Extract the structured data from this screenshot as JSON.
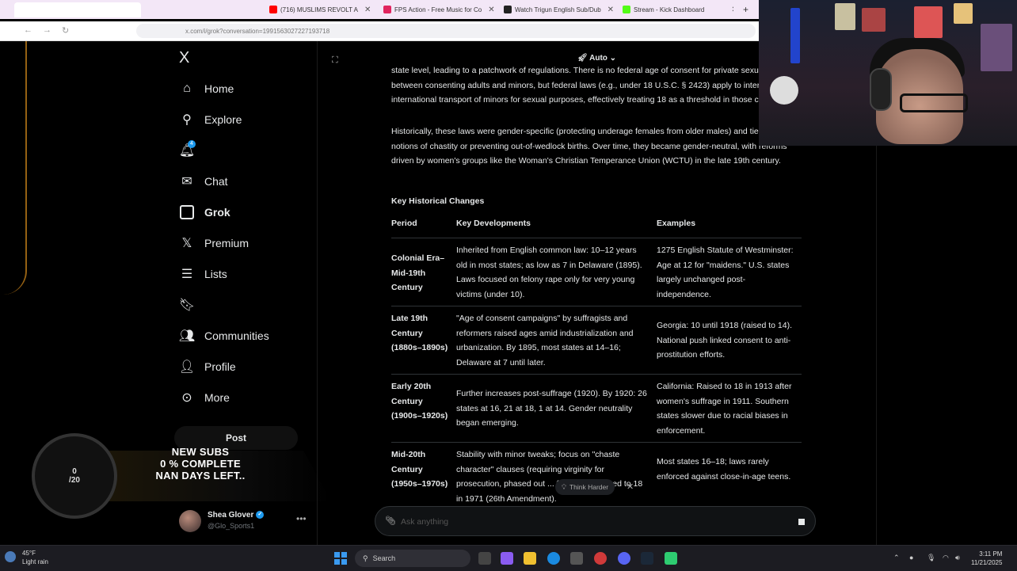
{
  "browser": {
    "tabs": [
      {
        "label": "",
        "color": "#ffffff"
      },
      {
        "label": "(716) MUSLIMS REVOLT A",
        "color": "#ff0000"
      },
      {
        "label": "FPS Action - Free Music for Co",
        "color": "#e0245e"
      },
      {
        "label": "Watch Trigun English Sub/Dub",
        "color": "#222222"
      },
      {
        "label": "Stream - Kick Dashboard",
        "color": "#53fc18"
      }
    ],
    "url": "x.com/i/grok?conversation=1991563027227193718"
  },
  "sidebar": {
    "logo": "X",
    "items": [
      {
        "label": "Home",
        "icon": "home-icon"
      },
      {
        "label": "Explore",
        "icon": "search-icon"
      },
      {
        "label": "",
        "icon": "bell-icon",
        "badge": "4"
      },
      {
        "label": "Chat",
        "icon": "mail-icon"
      },
      {
        "label": "Grok",
        "icon": "grok-icon"
      },
      {
        "label": "Premium",
        "icon": "x-logo-icon"
      },
      {
        "label": "Lists",
        "icon": "list-icon"
      },
      {
        "label": "",
        "icon": "bookmark-icon"
      },
      {
        "label": "Communities",
        "icon": "communities-icon"
      },
      {
        "label": "Profile",
        "icon": "person-icon"
      },
      {
        "label": "More",
        "icon": "more-circle-icon"
      }
    ],
    "post_label": "Post",
    "user": {
      "name": "Shea Glover",
      "handle": "@Glo_Sports1"
    }
  },
  "overlay": {
    "ring_top": "0",
    "ring_bottom": "/20",
    "line1": "NEW SUBS",
    "line2": "0 % COMPLETE",
    "line3": "NAN DAYS LEFT.."
  },
  "conversation": {
    "model": "Auto",
    "paragraph1": "state level, leading to a patchwork of regulations. There is no federal age of consent for private sexual activity between consenting adults and minors, but federal laws (e.g., under 18 U.S.C. § 2423) apply to interstate or international transport of minors for sexual purposes, effectively treating 18 as a threshold in those contexts.",
    "paragraph2": "Historically, these laws were gender-specific (protecting underage females from older males) and tied to notions of chastity or preventing out-of-wedlock births. Over time, they became gender-neutral, with reforms driven by women's groups like the Woman's Christian Temperance Union (WCTU) in the late 19th century.",
    "section_title": "Key Historical Changes",
    "table": {
      "headers": [
        "Period",
        "Key Developments",
        "Examples"
      ],
      "rows": [
        {
          "period": "Colonial Era–Mid-19th Century",
          "dev": "Inherited from English common law: 10–12 years old in most states; as low as 7 in Delaware (1895). Laws focused on felony rape only for very young victims (under 10).",
          "ex": "1275 English Statute of Westminster: Age at 12 for \"maidens.\" U.S. states largely unchanged post-independence."
        },
        {
          "period": "Late 19th Century (1880s–1890s)",
          "dev": "\"Age of consent campaigns\" by suffragists and reformers raised ages amid industrialization and urbanization. By 1895, most states at 14–16; Delaware at 7 until later.",
          "ex": "Georgia: 10 until 1918 (raised to 14). National push linked consent to anti-prostitution efforts."
        },
        {
          "period": "Early 20th Century (1900s–1920s)",
          "dev": "Further increases post-suffrage (1920). By 1920: 26 states at 16, 21 at 18, 1 at 14. Gender neutrality began emerging.",
          "ex": "California: Raised to 18 in 1913 after women's suffrage in 1911. Southern states slower due to racial biases in enforcement."
        },
        {
          "period": "Mid-20th Century (1950s–1970s)",
          "dev": "Stability with minor tweaks; focus on \"chaste character\" clauses (requiring virginity for prosecution, phased out ... f majority lowered to 18 in 1971 (26th Amendment).",
          "ex": "Most states 16–18; laws rarely enforced against close-in-age teens."
        }
      ]
    },
    "think_harder": "Think Harder",
    "ask_placeholder": "Ask anything"
  },
  "taskbar": {
    "weather_temp": "45°F",
    "weather_desc": "Light rain",
    "search_label": "Search",
    "time": "3:11 PM",
    "date": "11/21/2025"
  }
}
